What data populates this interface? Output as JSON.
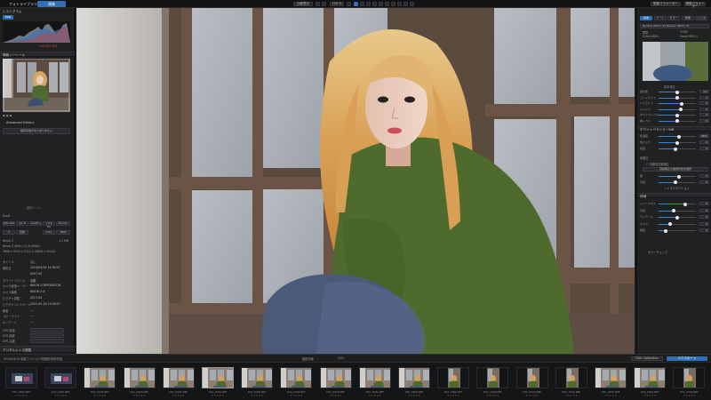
{
  "topbar": {
    "tab_library": "フォトライブラリ",
    "tab_develop": "現像",
    "center_buttons": [
      "比較表示",
      "100 %"
    ],
    "right_button_1": "現像パラメーター",
    "right_button_2": "現像パラメーター"
  },
  "left": {
    "histogram_title": "ヒストグラム",
    "histogram_mode": "RGB",
    "histogram_values": "255  255  255",
    "navigator_title": "情報ノートール",
    "advanced_history": "Advanced History",
    "history_button": "撮影情報がまだありません",
    "tools_title": "撮影ツール",
    "tool_section": "Draft",
    "tool_row1": [
      "ISO 100",
      "1/1.8",
      "1/125 s",
      "+0.0 EV",
      "50 mm"
    ],
    "tool_row2": [
      "F",
      "自動",
      "Auto",
      "RAW"
    ],
    "file_line1": "Nikon Z",
    "file_line1_val": "4.1 MB",
    "file_line2": "Nikon Z (8bit) 1/1.8 (RAW)",
    "file_line3": "3696 x 5504 (17/12.4 (3696 x 5504))",
    "meta_title_label": "タイトル",
    "meta_title_value": "なし",
    "meta_rows": [
      {
        "label": "撮影日",
        "value": "2024/09/16 14:36:07"
      },
      {
        "label": "",
        "value": "0007-00"
      },
      {
        "label": "ホワイトバランス",
        "value": "自動"
      },
      {
        "label": "カメラ製造メーカー",
        "value": "NIKON CORPORATION"
      },
      {
        "label": "カメラ機種",
        "value": "NIKON Z 8"
      },
      {
        "label": "ピクチャ調整",
        "value": "2017-06"
      },
      {
        "label": "ピクチャコントロール",
        "value": "2022-09-16 14:36:07"
      },
      {
        "label": "著者",
        "value": "—"
      },
      {
        "label": "コピーライト",
        "value": "—"
      },
      {
        "label": "キーワード",
        "value": "—"
      }
    ],
    "rating_rows": [
      "GPS 緯度",
      "GPS 経度",
      "GPS 高度"
    ],
    "bottom_label": "デジタルレンズ調整"
  },
  "right": {
    "tabs": [
      "基本",
      "トーン",
      "カラー",
      "詳細",
      "レンズ"
    ],
    "profile_label": "Neutral (Nikon Z) Neutral (Nikon Z)",
    "radio_1": "標準",
    "radio_2": "TONE",
    "radio_3": "Clear(HDR)",
    "radio_4": "DeepHDR(1)",
    "section_basic": "基本補正",
    "sliders_1": [
      {
        "label": "露光量",
        "value": "0.0",
        "pct": 0.5
      },
      {
        "label": "コントラスト",
        "value": "0",
        "pct": 0.5
      },
      {
        "label": "ハイライト",
        "value": "0",
        "pct": 0.62
      },
      {
        "label": "シャドウ",
        "value": "0",
        "pct": 0.6
      },
      {
        "label": "ホワイトレベル",
        "value": "0",
        "pct": 0.5
      },
      {
        "label": "黒レベル",
        "value": "0",
        "pct": 0.5
      }
    ],
    "section_wb": "ホワイトバランス・WB",
    "sliders_2": [
      {
        "label": "色温度",
        "value": "5600",
        "pct": 0.55
      },
      {
        "label": "色かぶり",
        "value": "0",
        "pct": 0.5
      },
      {
        "label": "彩度",
        "value": "0",
        "pct": 0.45
      }
    ],
    "section_color": "色補正",
    "checkbox_1": "自動色収差補正",
    "section_auto": "自動補正の適用対象を選択",
    "sliders_3": [
      {
        "label": "量",
        "value": "0",
        "pct": 0.55
      },
      {
        "label": "半径",
        "value": "0",
        "pct": 0.45
      }
    ],
    "sub_label": "ノイズリダクション",
    "section_detail": "詳細",
    "sliders_4": [
      {
        "label": "シャープネス",
        "value": "0",
        "pct": 0.72
      },
      {
        "label": "半径",
        "value": "0",
        "pct": 0.4
      },
      {
        "label": "ディテール",
        "value": "0",
        "pct": 0.5
      },
      {
        "label": "マスク",
        "value": "0",
        "pct": 0.3
      },
      {
        "label": "輝度",
        "value": "0",
        "pct": 0.2
      }
    ],
    "bottom_label": "カラーチェック"
  },
  "film": {
    "breadcrumb": "2024/09/16 撮影ファイル/人物撮影作例/作品",
    "sort_label": "撮影情報",
    "count_label": "1/51",
    "btn_collection": "Film Collection",
    "btn_export": "エクスポート",
    "thumbs": [
      {
        "cap": "DSC_0000.NEF",
        "kind": "dark"
      },
      {
        "cap": "DSC_0000.NEF",
        "kind": "dark"
      },
      {
        "cap": "DSC_0000.NEF",
        "kind": "scene"
      },
      {
        "cap": "DSC_0000.NEF",
        "kind": "scene"
      },
      {
        "cap": "DSC_0000.NEF",
        "kind": "scene"
      },
      {
        "cap": "DSC_0000.NEF",
        "kind": "scene",
        "sel": true
      },
      {
        "cap": "DSC_0000.NEF",
        "kind": "scene"
      },
      {
        "cap": "DSC_0000.NEF",
        "kind": "scene"
      },
      {
        "cap": "DSC_0000.NEF",
        "kind": "scene"
      },
      {
        "cap": "DSC_0000.NEF",
        "kind": "scene"
      },
      {
        "cap": "DSC_0000.NEF",
        "kind": "scene"
      },
      {
        "cap": "DSC_0000.NEF",
        "kind": "portrait"
      },
      {
        "cap": "DSC_0000.NEF",
        "kind": "portrait"
      },
      {
        "cap": "DSC_0000.NEF",
        "kind": "portrait"
      },
      {
        "cap": "DSC_0000.NEF",
        "kind": "portrait"
      },
      {
        "cap": "DSC_0000.NEF",
        "kind": "scene"
      },
      {
        "cap": "DSC_0000.NEF",
        "kind": "scene"
      },
      {
        "cap": "DSC_0000.NEF",
        "kind": "portrait"
      }
    ],
    "stars": "★★★★★"
  }
}
